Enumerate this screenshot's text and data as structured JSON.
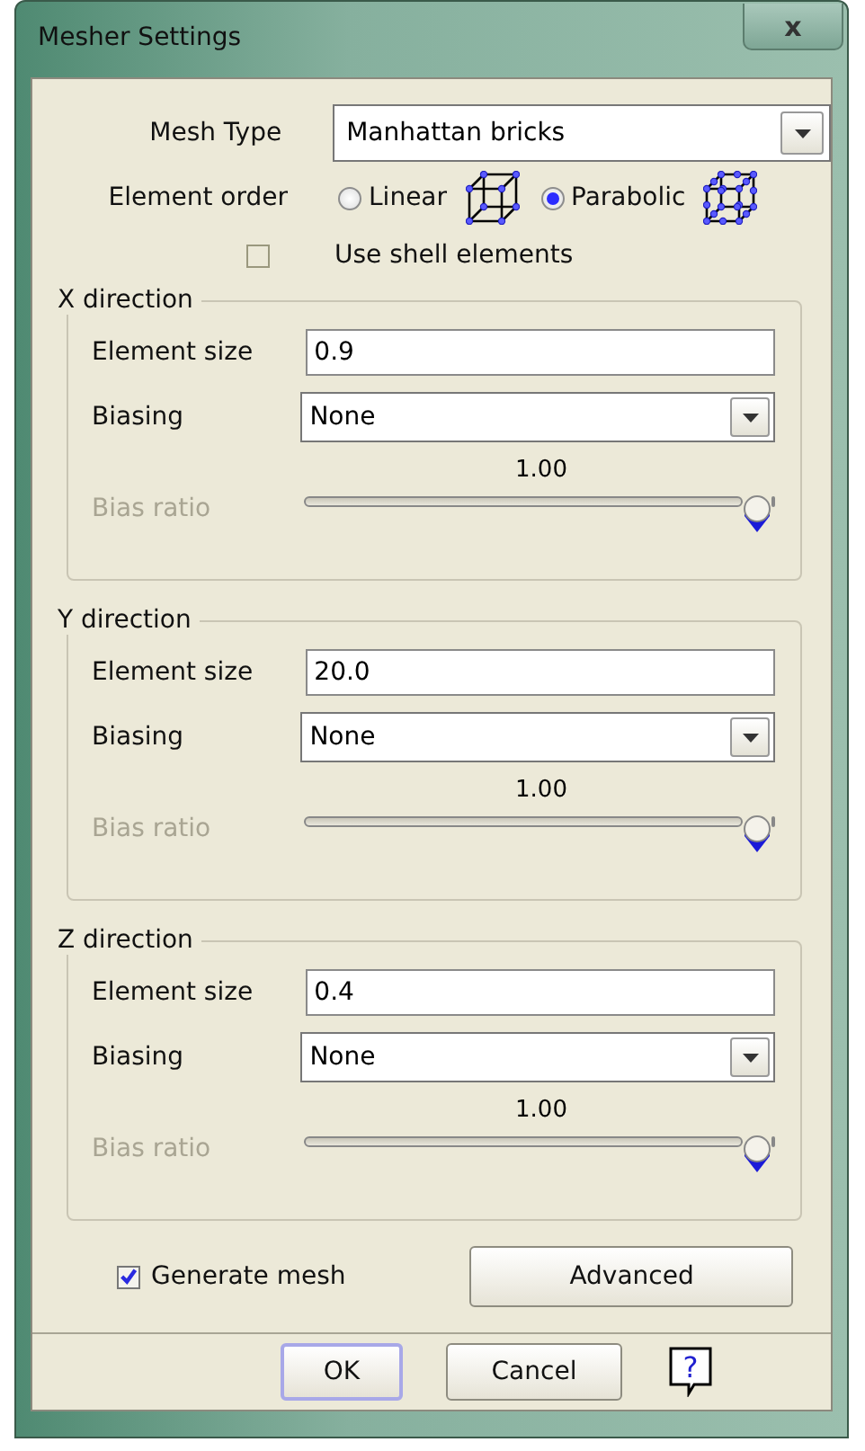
{
  "window": {
    "title": "Mesher Settings",
    "close": "x"
  },
  "mesh_type": {
    "label": "Mesh Type",
    "value": "Manhattan bricks"
  },
  "element_order": {
    "label": "Element order",
    "options": [
      {
        "label": "Linear",
        "selected": false,
        "kind": "linear"
      },
      {
        "label": "Parabolic",
        "selected": true,
        "kind": "parabolic"
      }
    ]
  },
  "shell": {
    "label": "Use shell elements",
    "checked": false
  },
  "directions": [
    {
      "title": "X direction",
      "size_label": "Element size",
      "size": "0.9",
      "biasing_label": "Biasing",
      "biasing": "None",
      "bias_label": "Bias ratio",
      "bias_disabled": true,
      "reading": "1.00",
      "level": 1
    },
    {
      "title": "Y direction",
      "size_label": "Element size",
      "size": "20.0",
      "biasing_label": "Biasing",
      "biasing": "None",
      "bias_label": "Bias ratio",
      "bias_disabled": true,
      "reading": "1.00",
      "level": 1
    },
    {
      "title": "Z direction",
      "size_label": "Element size",
      "size": "0.4",
      "biasing_label": "Biasing",
      "biasing": "None",
      "bias_label": "Bias ratio",
      "bias_disabled": true,
      "reading": "1.00",
      "level": 1
    }
  ],
  "generate": {
    "label": "Generate mesh",
    "checked": true
  },
  "advanced": "Advanced",
  "buttons": [
    {
      "label": "OK",
      "kind": "default"
    },
    {
      "label": "Cancel",
      "kind": "normal"
    }
  ],
  "help": "?"
}
